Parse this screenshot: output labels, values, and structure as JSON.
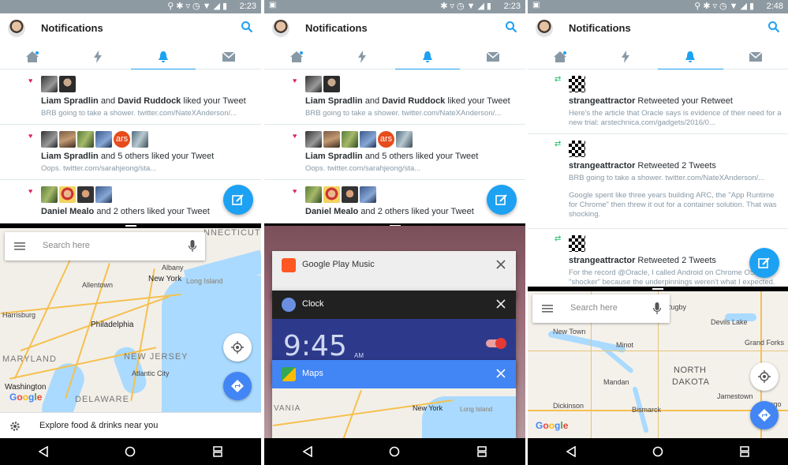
{
  "status": [
    {
      "time": "2:23"
    },
    {
      "time": "2:23"
    },
    {
      "time": "2:48"
    }
  ],
  "twitter": {
    "title": "Notifications",
    "tabs": [
      "home-icon",
      "moments-icon",
      "notifications-icon",
      "messages-icon"
    ]
  },
  "notifications_a": [
    {
      "u1": "Liam Spradlin",
      "mid": "and",
      "u2": "David Ruddock",
      "rest": "liked your Tweet",
      "sub": "BRB going to take a shower. twitter.com/NateXAnderson/..."
    },
    {
      "u1": "Liam Spradlin",
      "mid": "and 5 others liked your Tweet",
      "u2": "",
      "rest": "",
      "sub": "Oops. twitter.com/sarahjeong/sta..."
    },
    {
      "u1": "Daniel Mealo",
      "mid": "and 2 others liked your Tweet",
      "u2": "",
      "rest": "",
      "sub": ""
    }
  ],
  "notifications_c": [
    {
      "user": "strangeattractor",
      "rest": "Retweeted your Retweet",
      "sub": "Here's the article that Oracle says is evidence of their need for a new trial: arstechnica.com/gadgets/2016/0..."
    },
    {
      "user": "strangeattractor",
      "rest": "Retweeted 2 Tweets",
      "sub": "BRB going to take a shower. twitter.com/NateXAnderson/...",
      "sub2": "Google spent like three years building ARC, the \"App Runtime for Chrome\" then threw it out for a container solution. That was shocking."
    },
    {
      "user": "strangeattractor",
      "rest": "Retweeted 2 Tweets",
      "sub": "For the record @Oracle, I called Android on Chrome OS \"shocker\" because the underpinnings weren't what I expected."
    }
  ],
  "avatar_badge": "ars",
  "maps": {
    "search_placeholder": "Search here",
    "explore": "Explore food & drinks near you",
    "logo": "Google",
    "labels_east": {
      "albany": "Albany",
      "allentown": "Allentown",
      "newyork": "New York",
      "longisland": "Long Island",
      "harrisburg": "Harrisburg",
      "philadelphia": "Philadelphia",
      "maryland": "MARYLAND",
      "newjersey": "NEW JERSEY",
      "atlantic": "Atlantic City",
      "washington": "Washington",
      "delaware": "DELAWARE",
      "connecticut": "NNECTICUT",
      "vania": "VANIA"
    },
    "labels_dakota": {
      "rugby": "Rugby",
      "devilslake": "Devils Lake",
      "newtown": "New Town",
      "grandforks": "Grand Forks",
      "minot": "Minot",
      "northdakota1": "NORTH",
      "northdakota2": "DAKOTA",
      "fargo": "Fargo",
      "jamestown": "Jamestown",
      "bismarck": "Bismarck",
      "dickinson": "Dickinson",
      "mandan": "Mandan"
    }
  },
  "recents": [
    {
      "label": "Google Play Music",
      "color": "#ff5722"
    },
    {
      "label": "Clock",
      "color": "#4a90e2"
    },
    {
      "label": "Maps",
      "color": "#34a853"
    }
  ],
  "clock": {
    "time": "9:45",
    "ampm": "AM"
  },
  "colors": {
    "twitter_blue": "#1da1f2",
    "like": "#e0245e",
    "retweet": "#17bf63",
    "maps_blue": "#4285f4"
  }
}
